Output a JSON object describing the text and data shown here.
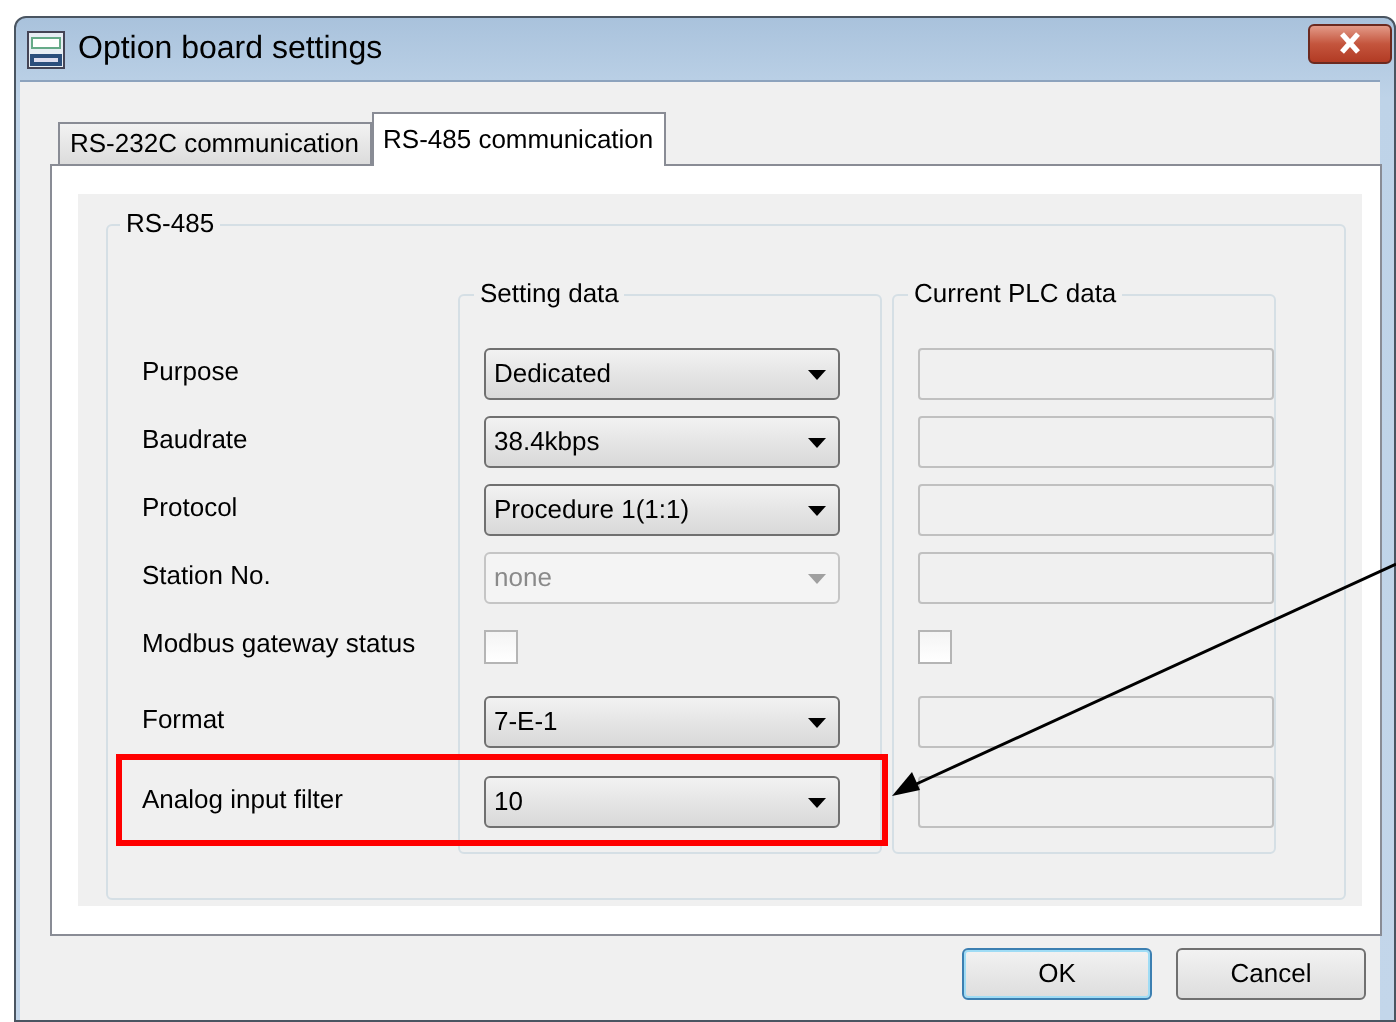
{
  "window": {
    "title": "Option board settings"
  },
  "tabs": [
    {
      "label": "RS-232C communication",
      "selected": false
    },
    {
      "label": "RS-485 communication",
      "selected": true
    }
  ],
  "group": {
    "title": "RS-485",
    "columns": [
      "Setting data",
      "Current PLC data"
    ],
    "rows": [
      {
        "label": "Purpose",
        "kind": "dropdown",
        "value": "Dedicated",
        "disabled": false,
        "highlighted": false
      },
      {
        "label": "Baudrate",
        "kind": "dropdown",
        "value": "38.4kbps",
        "disabled": false,
        "highlighted": false
      },
      {
        "label": "Protocol",
        "kind": "dropdown",
        "value": "Procedure 1(1:1)",
        "disabled": false,
        "highlighted": false
      },
      {
        "label": "Station No.",
        "kind": "dropdown",
        "value": "none",
        "disabled": true,
        "highlighted": false
      },
      {
        "label": "Modbus gateway status",
        "kind": "checkbox",
        "checked": false,
        "plc_checked": false,
        "highlighted": false
      },
      {
        "label": "Format",
        "kind": "dropdown",
        "value": "7-E-1",
        "disabled": false,
        "highlighted": false
      },
      {
        "label": "Analog input filter",
        "kind": "dropdown",
        "value": "10",
        "disabled": false,
        "highlighted": true
      }
    ]
  },
  "buttons": [
    {
      "label": "OK",
      "default": true
    },
    {
      "label": "Cancel",
      "default": false
    }
  ]
}
